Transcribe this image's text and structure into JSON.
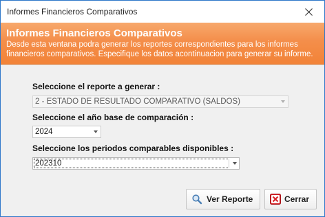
{
  "window": {
    "title": "Informes Financieros Comparativos"
  },
  "banner": {
    "title": "Informes Financieros Comparativos",
    "description": "Desde esta ventana podra generar los reportes correspondientes para los informes financieros comparativos. Especifique los datos acontinuacion para generar su informe."
  },
  "form": {
    "report_label": "Seleccione el reporte a generar :",
    "report_value": "2 - ESTADO DE RESULTADO COMPARATIVO (SALDOS)",
    "year_label": "Seleccione el año base de comparación :",
    "year_value": "2024",
    "periods_label": "Seleccione los periodos comparables disponibles :",
    "periods_value": "202310"
  },
  "buttons": {
    "view_report": "Ver Reporte",
    "close": "Cerrar"
  },
  "icons": {
    "close": "close-icon",
    "search": "magnifier-icon",
    "cancel": "red-x-icon",
    "dropdown": "chevron-down-icon"
  },
  "colors": {
    "banner_orange": "#f28338",
    "window_border": "#2d77c9",
    "cancel_red": "#d9252a"
  }
}
